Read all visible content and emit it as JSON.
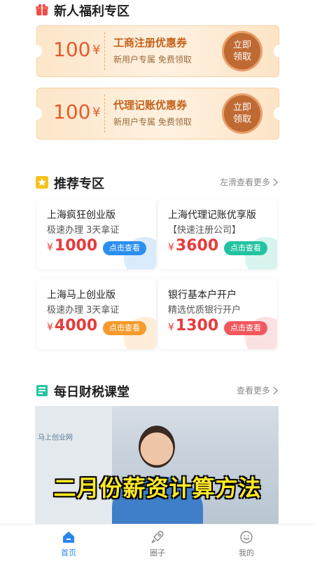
{
  "welfare": {
    "title": "新人福利专区",
    "coupons": [
      {
        "amount": "100",
        "currency": "¥",
        "name": "工商注册优惠券",
        "sub": "新用户专属 免费领取",
        "claim_line1": "立即",
        "claim_line2": "领取"
      },
      {
        "amount": "100",
        "currency": "¥",
        "name": "代理记账优惠券",
        "sub": "新用户专属 免费领取",
        "claim_line1": "立即",
        "claim_line2": "领取"
      }
    ]
  },
  "recommend": {
    "title": "推荐专区",
    "more": "左滑查看更多",
    "products": [
      {
        "name": "上海疯狂创业版",
        "sub": "极速办理 3天拿证",
        "currency": "¥",
        "price": "1000",
        "button": "点击查看",
        "color": "#2b8ff0"
      },
      {
        "name": "上海代理记账优享版",
        "sub": "【快速注册公司】",
        "currency": "¥",
        "price": "3600",
        "button": "点击查看",
        "color": "#21c3a0"
      },
      {
        "name": "上海马上创业版",
        "sub": "极速办理 3天拿证",
        "currency": "¥",
        "price": "4000",
        "button": "点击查看",
        "color": "#f59a2c"
      },
      {
        "name": "银行基本户开户",
        "sub": "精选优质银行开户",
        "currency": "¥",
        "price": "1300",
        "button": "点击查看",
        "color": "#f0585e"
      }
    ]
  },
  "classroom": {
    "title": "每日财税课堂",
    "more": "查看更多",
    "video_title": "二月份薪资计算方法",
    "video_sign": "马上创业网"
  },
  "tabs": [
    {
      "label": "首页",
      "icon": "home-icon",
      "active": true
    },
    {
      "label": "圈子",
      "icon": "rocket-icon",
      "active": false
    },
    {
      "label": "我的",
      "icon": "smile-icon",
      "active": false
    }
  ],
  "colors": {
    "accent": "#2a86ee",
    "price": "#e83b3b",
    "coupon_text": "#c4621c"
  }
}
